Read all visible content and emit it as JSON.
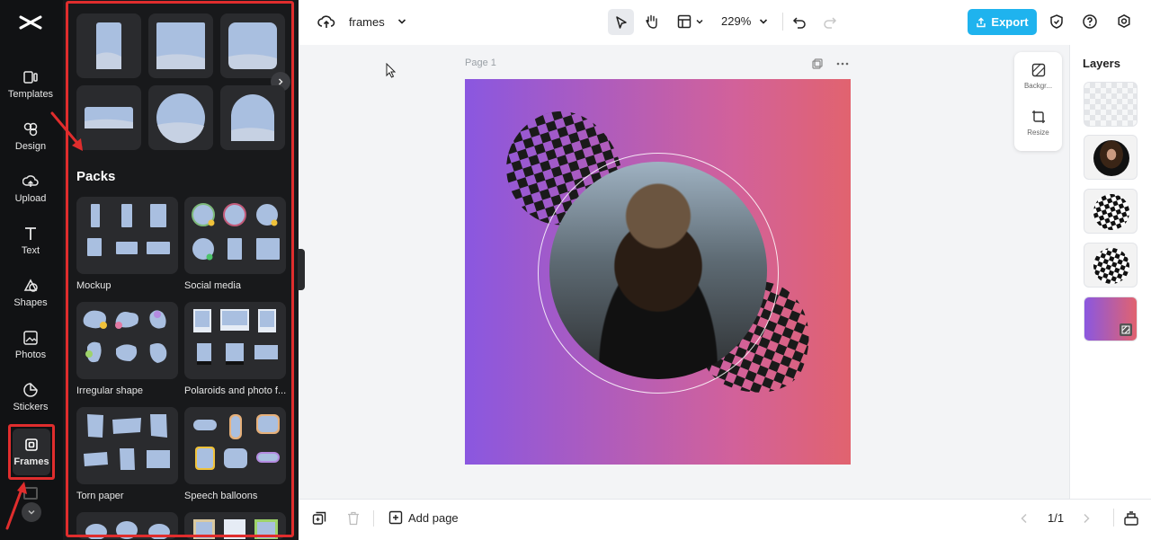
{
  "app": {
    "doc_name": "frames",
    "zoom": "229%",
    "export_label": "Export"
  },
  "rail": {
    "items": [
      {
        "label": "Templates",
        "icon": "templates-icon"
      },
      {
        "label": "Design",
        "icon": "design-icon"
      },
      {
        "label": "Upload",
        "icon": "upload-icon"
      },
      {
        "label": "Text",
        "icon": "text-icon"
      },
      {
        "label": "Shapes",
        "icon": "shapes-icon"
      },
      {
        "label": "Photos",
        "icon": "photos-icon"
      },
      {
        "label": "Stickers",
        "icon": "stickers-icon"
      },
      {
        "label": "Frames",
        "icon": "frames-icon",
        "active": true
      }
    ]
  },
  "panel": {
    "packs_title": "Packs",
    "packs": [
      {
        "label": "Mockup"
      },
      {
        "label": "Social media"
      },
      {
        "label": "Irregular shape"
      },
      {
        "label": "Polaroids and photo f..."
      },
      {
        "label": "Torn paper"
      },
      {
        "label": "Speech balloons"
      }
    ]
  },
  "canvas": {
    "page_label": "Page 1"
  },
  "float_tools": {
    "background_label": "Backgr...",
    "resize_label": "Resize"
  },
  "layers": {
    "title": "Layers"
  },
  "bottom": {
    "add_page_label": "Add page",
    "page_count": "1/1"
  },
  "colors": {
    "highlight": "#e02d2d",
    "export": "#1fb3ee",
    "rail_bg": "#111214",
    "panel_bg": "#18191b"
  }
}
